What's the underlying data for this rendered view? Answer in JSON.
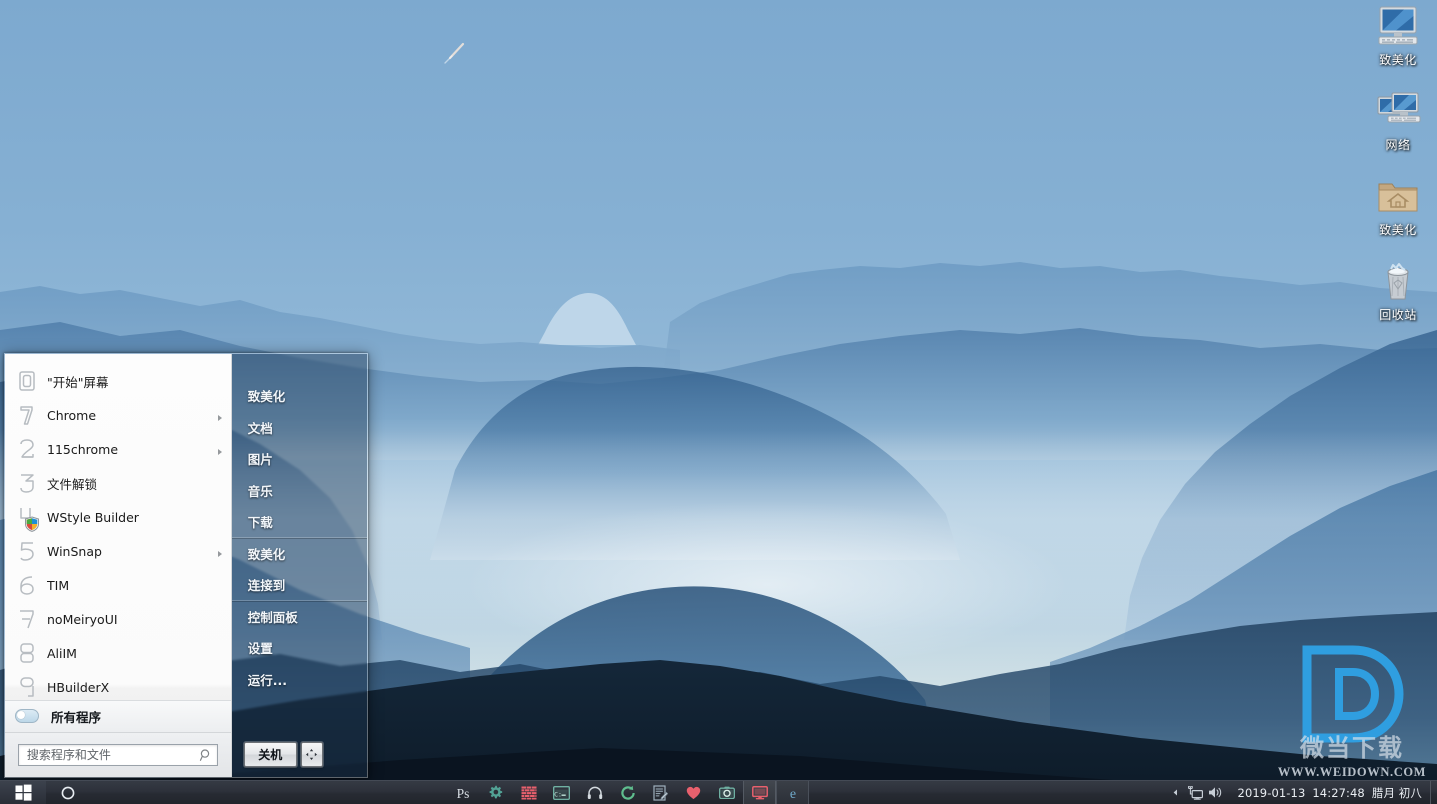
{
  "desktop": {
    "icons": [
      {
        "label": "致美化",
        "icon": "monitor-icon"
      },
      {
        "label": "网络",
        "icon": "network-icon"
      },
      {
        "label": "致美化",
        "icon": "folder-home-icon"
      },
      {
        "label": "回收站",
        "icon": "recycle-bin-icon"
      }
    ]
  },
  "watermark": {
    "logo": "d-logo-icon",
    "chinese": "微当下载",
    "url": "WWW.WEIDOWN.COM"
  },
  "start_menu": {
    "programs": [
      {
        "label": "\"开始\"屏幕",
        "icon": "digit-0-icon",
        "submenu": false
      },
      {
        "label": "Chrome",
        "icon": "digit-1-icon",
        "submenu": true
      },
      {
        "label": "115chrome",
        "icon": "digit-2-icon",
        "submenu": true
      },
      {
        "label": "文件解锁",
        "icon": "digit-3-icon",
        "submenu": false
      },
      {
        "label": "WStyle Builder",
        "icon": "digit-4-icon",
        "submenu": false
      },
      {
        "label": "WinSnap",
        "icon": "digit-5-icon",
        "submenu": true
      },
      {
        "label": "TIM",
        "icon": "digit-6-icon",
        "submenu": false
      },
      {
        "label": "noMeiryoUI",
        "icon": "digit-7-icon",
        "submenu": false
      },
      {
        "label": "AliIM",
        "icon": "digit-8-icon",
        "submenu": false
      },
      {
        "label": "HBuilderX",
        "icon": "digit-9-icon",
        "submenu": false
      }
    ],
    "all_programs": {
      "label": "所有程序",
      "icon": "toggle-icon"
    },
    "search": {
      "placeholder": "搜索程序和文件",
      "value": "",
      "icon": "search-icon"
    },
    "places": [
      {
        "label": "致美化",
        "separator_after": false
      },
      {
        "label": "文档",
        "separator_after": false
      },
      {
        "label": "图片",
        "separator_after": false
      },
      {
        "label": "音乐",
        "separator_after": false
      },
      {
        "label": "下载",
        "separator_after": true
      },
      {
        "label": "致美化",
        "separator_after": false
      },
      {
        "label": "连接到",
        "separator_after": true
      },
      {
        "label": "控制面板",
        "separator_after": false
      },
      {
        "label": "设置",
        "separator_after": false
      },
      {
        "label": "运行...",
        "separator_after": false
      }
    ],
    "power": {
      "label": "关机",
      "arrow_icon": "power-options-arrow-icon"
    }
  },
  "taskbar": {
    "start_button": {
      "icon": "windows-logo-icon"
    },
    "search_button": {
      "icon": "cortana-circle-icon"
    },
    "apps": [
      {
        "name": "Photoshop",
        "icon": "photoshop-icon",
        "state": "normal"
      },
      {
        "name": "设置",
        "icon": "gear-icon",
        "state": "normal"
      },
      {
        "name": "防火墙",
        "icon": "firewall-icon",
        "state": "normal"
      },
      {
        "name": "命令行",
        "icon": "console-icon",
        "state": "normal"
      },
      {
        "name": "耳机",
        "icon": "headphones-icon",
        "state": "normal"
      },
      {
        "name": "同步",
        "icon": "sync-icon",
        "state": "normal"
      },
      {
        "name": "记事本",
        "icon": "notepad-icon",
        "state": "normal"
      },
      {
        "name": "收藏",
        "icon": "heart-icon",
        "state": "normal"
      },
      {
        "name": "相机",
        "icon": "camera-icon",
        "state": "normal"
      },
      {
        "name": "显示器",
        "icon": "monitor-red-icon",
        "state": "active"
      },
      {
        "name": "Microsoft Edge",
        "icon": "edge-icon",
        "state": "semi"
      }
    ],
    "tray": [
      {
        "name": "显示隐藏的图标",
        "icon": "chevron-up-icon"
      },
      {
        "name": "网络",
        "icon": "network-tray-icon"
      },
      {
        "name": "音量",
        "icon": "volume-icon"
      }
    ],
    "clock": {
      "date": "2019-01-13",
      "time": "14:27:48",
      "lunar": "腊月 初八"
    }
  },
  "colors": {
    "taskbar": "#2b2f38",
    "accent_red": "#e8606d",
    "accent_teal": "#5fa79a",
    "watermark_blue": "#2f9ee0",
    "sky": "#7ba7cd"
  }
}
